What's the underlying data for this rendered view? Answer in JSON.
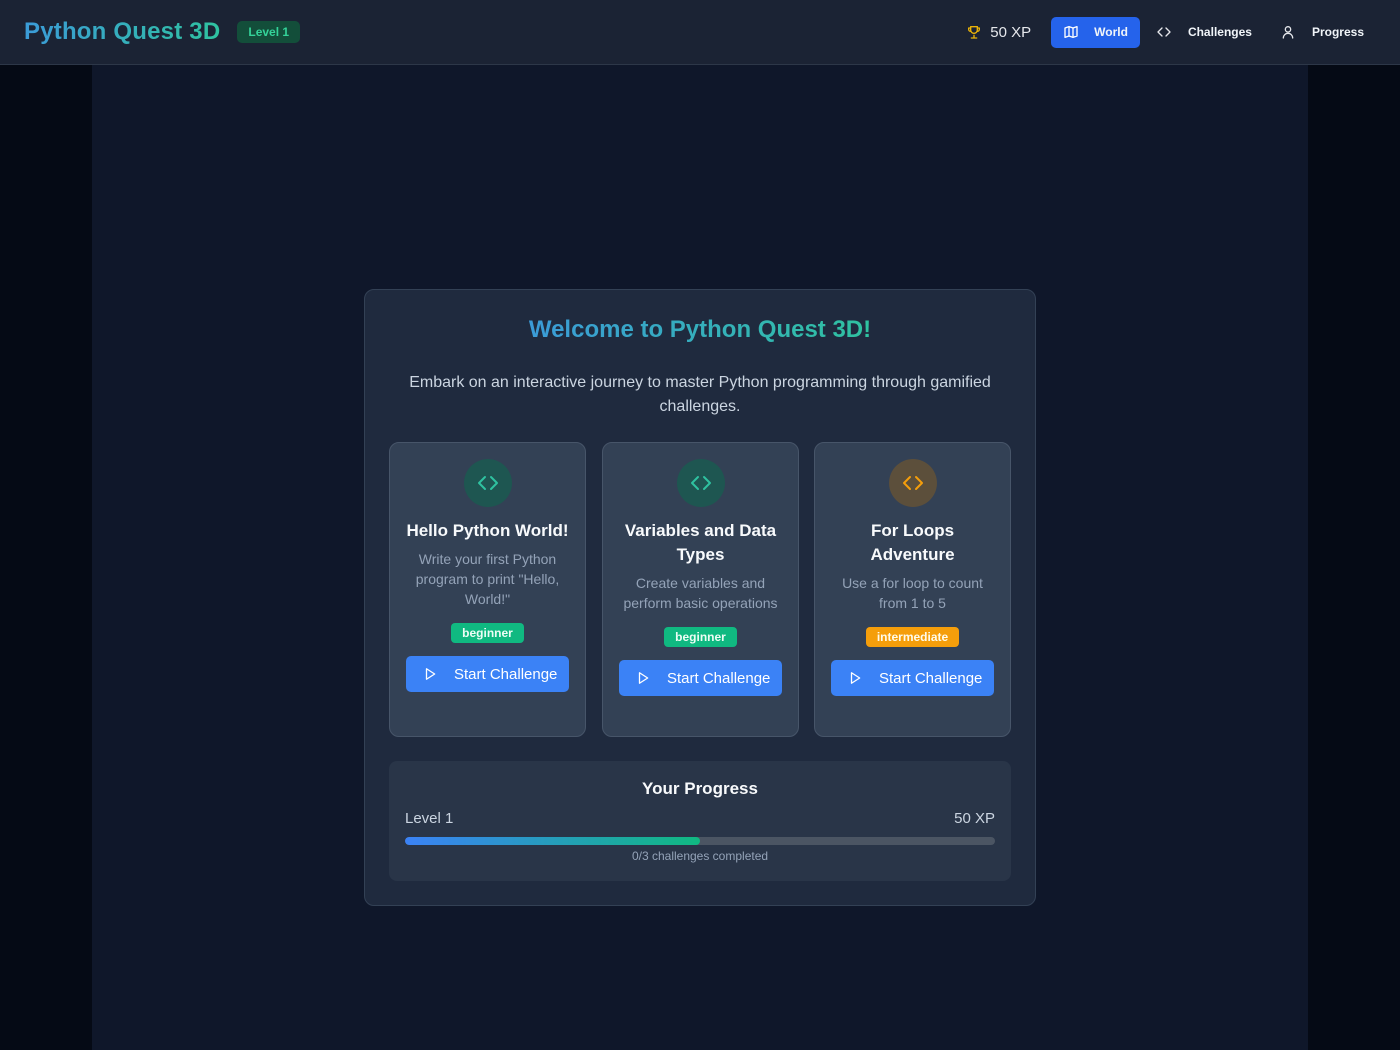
{
  "header": {
    "title": "Python Quest 3D",
    "level_badge": "Level 1",
    "xp": "50 XP",
    "nav": [
      {
        "label": "World",
        "icon": "map-icon",
        "active": true
      },
      {
        "label": "Challenges",
        "icon": "code-icon",
        "active": false
      },
      {
        "label": "Progress",
        "icon": "user-icon",
        "active": false
      }
    ]
  },
  "welcome": {
    "title": "Welcome to Python Quest 3D!",
    "intro": "Embark on an interactive journey to master Python programming through gamified challenges."
  },
  "challenges": [
    {
      "title": "Hello Python World!",
      "description": "Write your first Python program to print \"Hello, World!\"",
      "difficulty": "beginner",
      "button": "Start Challenge",
      "icon_color": "#2fc2a0"
    },
    {
      "title": "Variables and Data Types",
      "description": "Create variables and perform basic operations",
      "difficulty": "beginner",
      "button": "Start Challenge",
      "icon_color": "#2fc2a0"
    },
    {
      "title": "For Loops Adventure",
      "description": "Use a for loop to count from 1 to 5",
      "difficulty": "intermediate",
      "button": "Start Challenge",
      "icon_color": "#f59e0b"
    }
  ],
  "progress": {
    "title": "Your Progress",
    "level": "Level 1",
    "xp": "50 XP",
    "fill_fraction": 0.5,
    "caption": "0/3 challenges completed"
  },
  "colors": {
    "accent": "#2563eb",
    "button": "#3b82f6",
    "beginner": "#10b981",
    "intermediate": "#f59e0b",
    "brand_gradient_start": "#3b9bd8",
    "brand_gradient_end": "#2fc2a0"
  }
}
